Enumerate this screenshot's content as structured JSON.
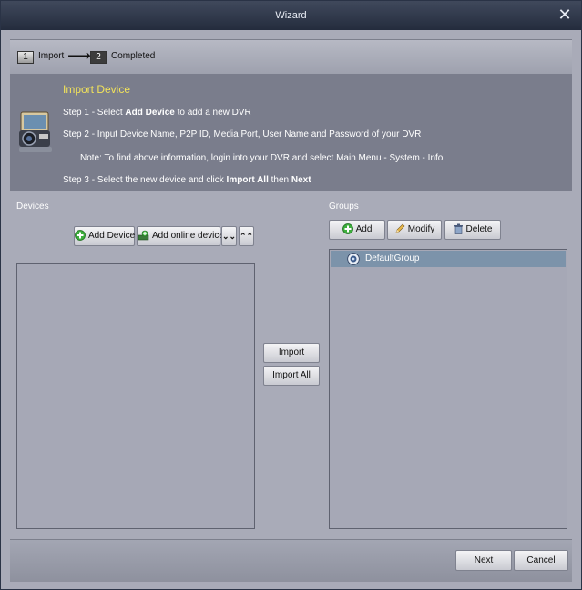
{
  "window": {
    "title": "Wizard"
  },
  "steps": [
    {
      "number": "1",
      "label": "Import"
    },
    {
      "number": "2",
      "label": "Completed"
    }
  ],
  "info": {
    "title": "Import Device",
    "step1": {
      "pre": "Step 1 - Select ",
      "bold": "Add Device",
      "post": " to add a new DVR"
    },
    "step2": "Step 2 - Input Device Name, P2P ID, Media Port, User Name and Password of your DVR",
    "note": "Note: To find above information, login into your DVR and select Main Menu - System - Info",
    "step3": {
      "pre": "Step 3 - Select the new device and click ",
      "bold1": "Import All",
      "mid": " then ",
      "bold2": "Next"
    }
  },
  "devices": {
    "label": "Devices",
    "add_device": "Add Device",
    "add_online_device": "Add online device",
    "expand_icon": "double-chevron-down-icon",
    "collapse_icon": "double-chevron-up-icon",
    "items": []
  },
  "transfer": {
    "import": "Import",
    "import_all": "Import All"
  },
  "groups": {
    "label": "Groups",
    "add": "Add",
    "modify": "Modify",
    "delete": "Delete",
    "items": [
      {
        "name": "DefaultGroup",
        "icon": "group-camera-icon"
      }
    ]
  },
  "footer": {
    "next": "Next",
    "cancel": "Cancel"
  }
}
